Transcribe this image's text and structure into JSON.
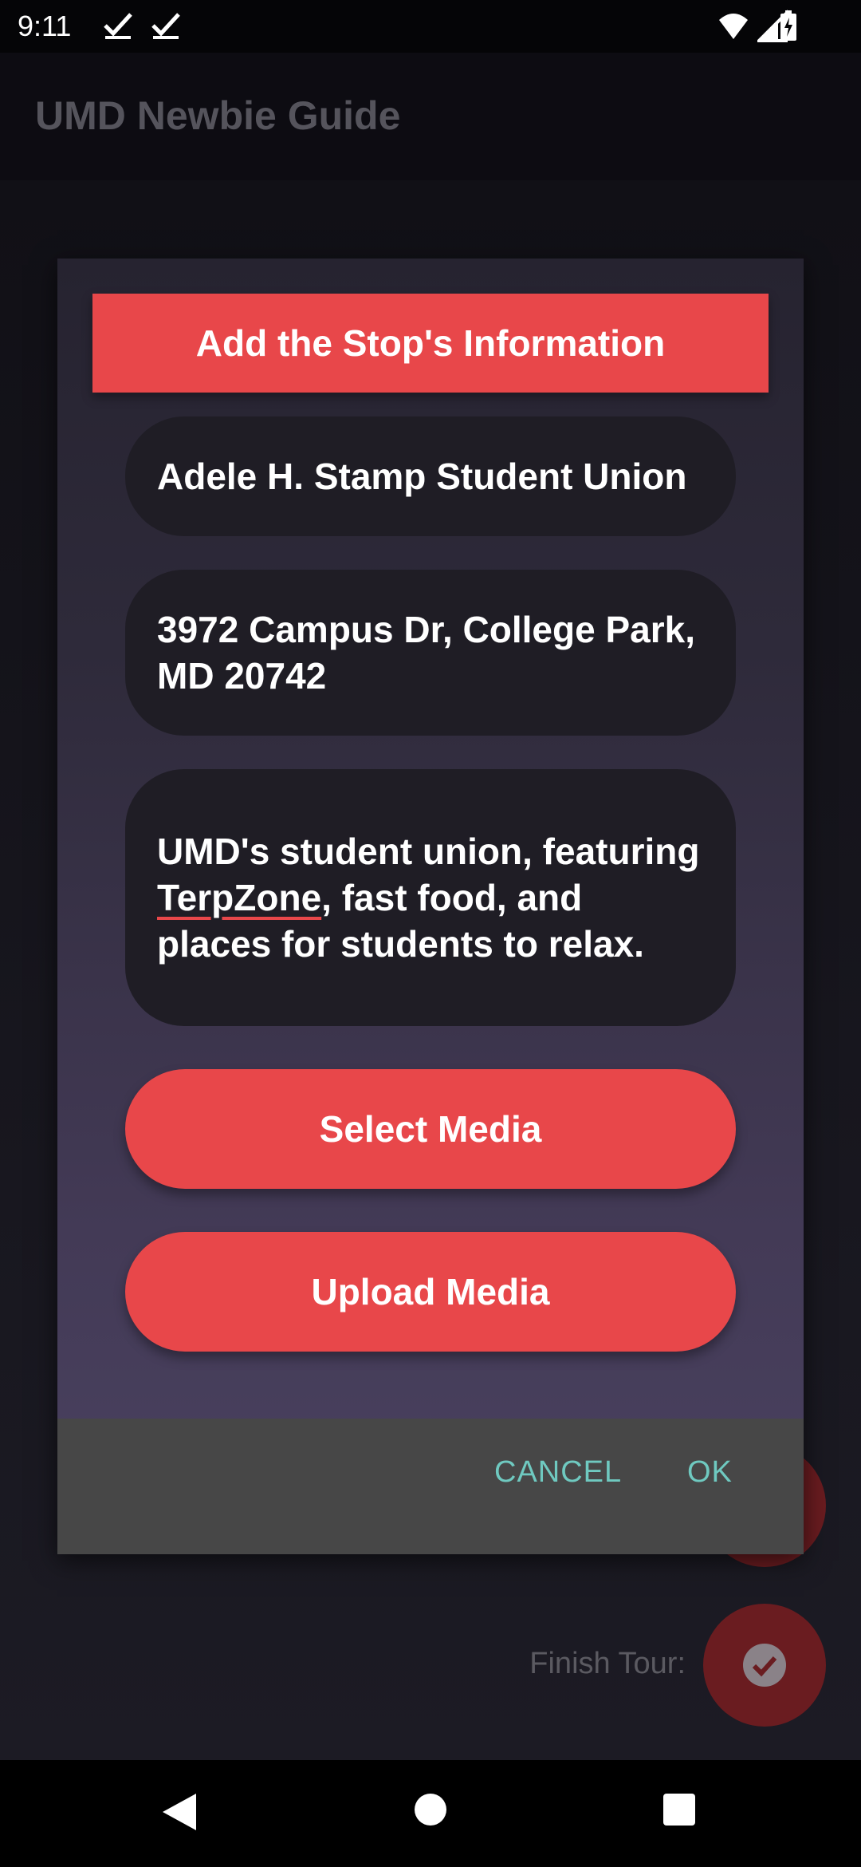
{
  "status_bar": {
    "time": "9:11",
    "icons": [
      "check-icon",
      "check-icon",
      "wifi-icon",
      "signal-icon",
      "battery-icon"
    ]
  },
  "app": {
    "title": "UMD Newbie Guide"
  },
  "dialog": {
    "header": "Add the Stop's Information",
    "name_field": "Adele H. Stamp Student Union",
    "address_field": "3972 Campus Dr, College Park, MD 20742",
    "description_field": {
      "before": "UMD's student union, featuring ",
      "underlined": "TerpZone",
      "after": ", fast food, and places for students to relax."
    },
    "select_media_label": "Select Media",
    "upload_media_label": "Upload Media",
    "cancel_label": "CANCEL",
    "ok_label": "OK"
  },
  "background": {
    "finish_label": "Finish Tour:"
  },
  "colors": {
    "accent": "#e8474a",
    "action_text": "#6fc9c0",
    "field_bg": "#1f1d25"
  },
  "nav_bar": {
    "icons": [
      "back-icon",
      "home-icon",
      "recents-icon"
    ]
  }
}
